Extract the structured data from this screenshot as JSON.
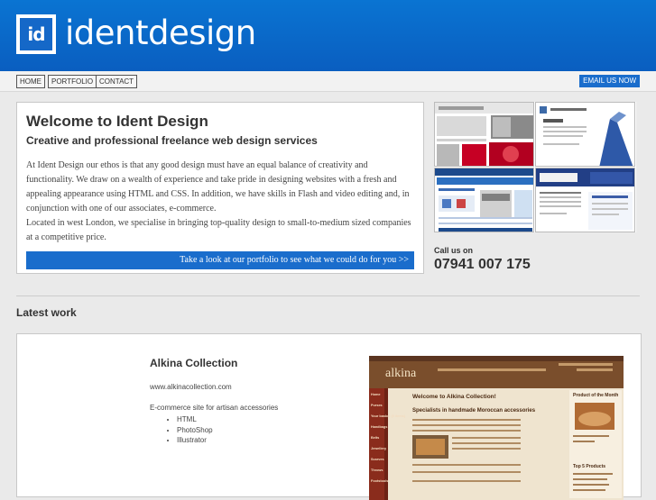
{
  "header": {
    "logo_mark": "id",
    "logo_text": "identdesign"
  },
  "nav": {
    "items": [
      {
        "label": "HOME"
      },
      {
        "label": "PORTFOLIO"
      },
      {
        "label": "CONTACT"
      }
    ],
    "email_label": "EMAIL US NOW"
  },
  "welcome": {
    "title": "Welcome to Ident Design",
    "subtitle": "Creative and professional freelance web design services",
    "para1": "At Ident Design our ethos is that any good design must have an equal balance of creativity and functionality. We draw on a wealth of experience and take pride in designing websites with a fresh and appealing appearance using HTML and CSS. In addition, we have skills in Flash and video editing and, in conjunction with one of our associates, e-commerce.",
    "para2": "Located in west London, we specialise in bringing top-quality design to small-to-medium sized companies at a competitive price.",
    "cta": "Take a look at our portfolio to see what we could do for you >>"
  },
  "contact": {
    "call_label": "Call us on",
    "phone": "07941 007 175"
  },
  "latest": {
    "heading": "Latest work",
    "title": "Alkina Collection",
    "url": "www.alkinacollection.com",
    "description": "E-commerce site for artisan accessories",
    "skills": [
      "HTML",
      "PhotoShop",
      "Illustrator"
    ],
    "screenshot": {
      "brand": "alkina",
      "welcome": "Welcome to Alkina Collection!",
      "tagline": "Specialists in handmade Moroccan accessories",
      "product_heading": "Product of the Month",
      "top_heading": "Top 5 Products",
      "menu": [
        "Home",
        "Purses",
        "Your basket (0 items)",
        "Handbags",
        "Belts",
        "Jewellery",
        "Scarves",
        "Throws",
        "Footstools"
      ]
    }
  },
  "colors": {
    "brand_blue": "#0a6bcc",
    "panel_border": "#c8c8c8"
  }
}
